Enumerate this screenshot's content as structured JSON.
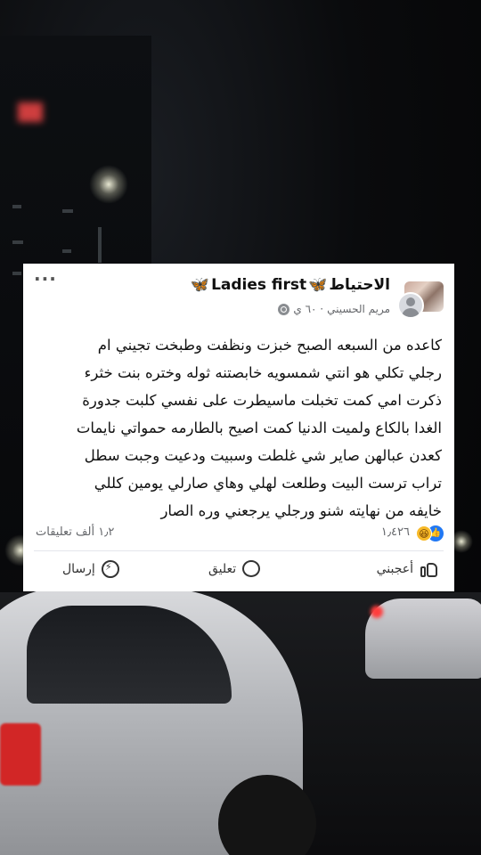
{
  "post": {
    "group_name": "Ladies first",
    "group_suffix": "الاحتياط",
    "author": "مريم الحسيني",
    "time": "٦٠ ي ·",
    "body_lines": [
      "كاعده من السبعه الصبح خبزت ونظفت وطبخت تجيني ام",
      "رجلي تكلي هو انتي شمسويه خابصتنه ثوله وختره بنت خثرء",
      "ذكرت امي  كمت تخبلت ماسيطرت على نفسي كلبت جدورة",
      "الغدا بالكاع ولميت الدنيا كمت اصيح بالطارمه حمواتي نايمات",
      "كعدن عبالهن صاير شي غلطت وسبيت ودعيت وجبت سطل",
      "تراب ترست البيت وطلعت لهلي وهاي صارلي يومين كللي",
      "خايفه من نهايته شنو ورجلي يرجعني وره الصار"
    ],
    "reactions_count": "١٫٤٢٦",
    "comments_count": "١٫٢ ألف تعليقات",
    "actions": {
      "like": "أعجبني",
      "comment": "تعليق",
      "send": "إرسال"
    }
  }
}
